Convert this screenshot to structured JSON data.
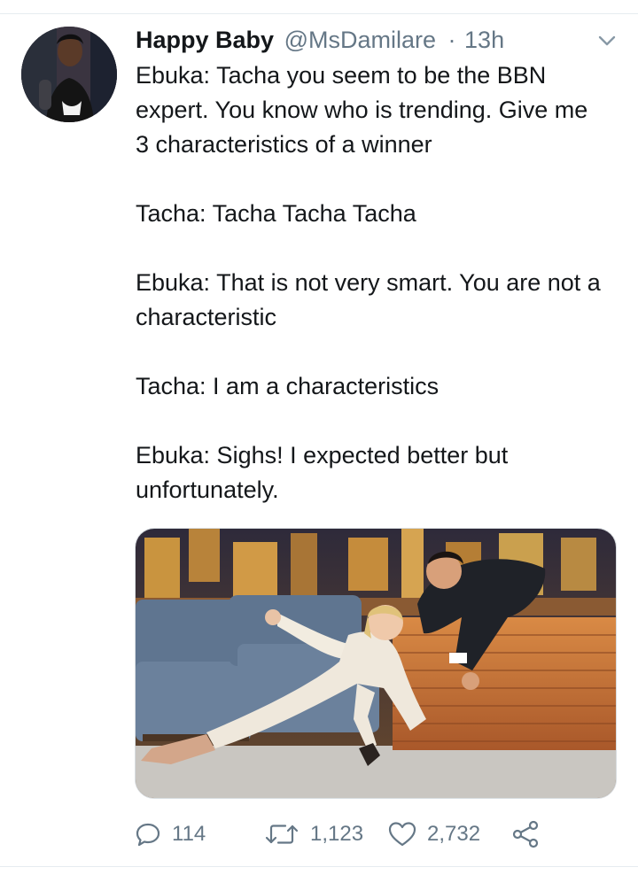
{
  "tweet": {
    "display_name": "Happy Baby",
    "handle": "@MsDamilare",
    "separator": "·",
    "timestamp": "13h",
    "text": "Ebuka: Tacha you seem to be the BBN expert. You know who is trending. Give me 3 characteristics of a winner\n\nTacha: Tacha Tacha Tacha\n\nEbuka: That is not very smart. You are not a characteristic\n\nTacha: I am a characteristics\n\nEbuka: Sighs! I expected better but unfortunately."
  },
  "actions": {
    "reply_count": "114",
    "retweet_count": "1,123",
    "like_count": "2,732"
  },
  "icons": {
    "reply": "reply-icon",
    "retweet": "retweet-icon",
    "like": "heart-icon",
    "share": "share-icon",
    "menu": "chevron-down-icon"
  },
  "colors": {
    "text": "#14171a",
    "secondary": "#657786",
    "divider": "#e6ecf0"
  }
}
